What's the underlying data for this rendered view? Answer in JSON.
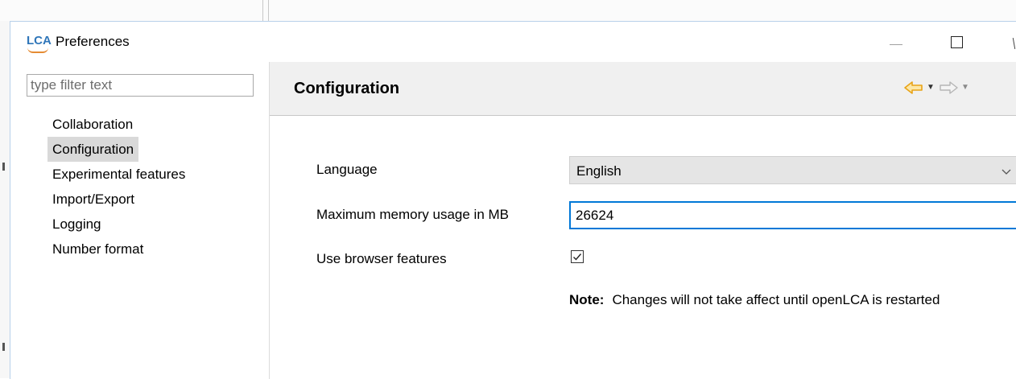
{
  "window": {
    "app_logo": "LCA",
    "title": "Preferences"
  },
  "sidebar": {
    "filter_placeholder": "type filter text",
    "items": [
      {
        "label": "Collaboration",
        "selected": false
      },
      {
        "label": "Configuration",
        "selected": true
      },
      {
        "label": "Experimental features",
        "selected": false
      },
      {
        "label": "Import/Export",
        "selected": false
      },
      {
        "label": "Logging",
        "selected": false
      },
      {
        "label": "Number format",
        "selected": false
      }
    ]
  },
  "page": {
    "title": "Configuration",
    "nav": {
      "back_icon": "arrow-left-icon",
      "forward_icon": "arrow-right-icon",
      "accent": "#e8a317"
    }
  },
  "form": {
    "language_label": "Language",
    "language_value": "English",
    "memory_label": "Maximum memory usage in MB",
    "memory_value": "26624",
    "browser_label": "Use browser features",
    "browser_checked": true,
    "note_label": "Note:",
    "note_text": "Changes will not take affect until openLCA is restarted"
  }
}
